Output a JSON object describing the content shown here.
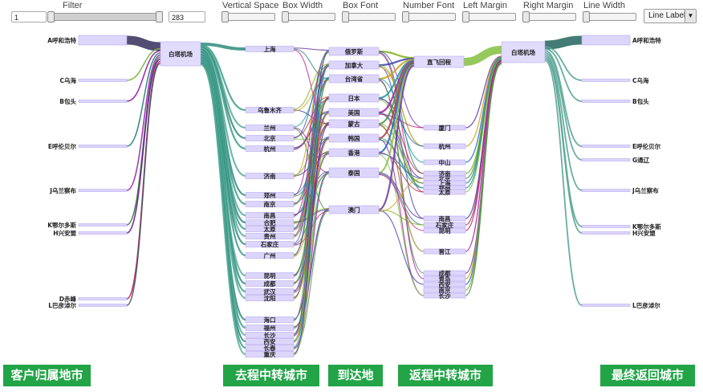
{
  "controls": {
    "filter": {
      "label": "Filter",
      "min_value": "1",
      "max_value": "283"
    },
    "sliders": [
      {
        "label": "Vertical Space"
      },
      {
        "label": "Box Width"
      },
      {
        "label": "Box Font"
      },
      {
        "label": "Number Font"
      },
      {
        "label": "Left Margin"
      },
      {
        "label": "Right Margin"
      },
      {
        "label": "Line Width"
      }
    ],
    "line_label_select": "Line Label"
  },
  "stages": [
    "客户归属地市",
    "去程中转城市",
    "到达地",
    "返程中转城市",
    "最终返回城市"
  ],
  "nodes": {
    "origin": [
      "A呼和浩特",
      "C乌海",
      "B包头",
      "E呼伦贝尔",
      "J乌兰察布",
      "K鄂尔多斯",
      "H兴安盟",
      "D赤峰",
      "L巴彦淖尔"
    ],
    "departure_hub": [
      "白塔机场"
    ],
    "outbound_transfer": [
      "上海",
      "乌鲁木齐",
      "兰州",
      "北京",
      "杭州",
      "济南",
      "郑州",
      "南京",
      "南昌",
      "合肥",
      "太原",
      "贵州",
      "石家庄",
      "广州",
      "昆明",
      "成都",
      "武汉",
      "沈阳",
      "海口",
      "福州",
      "长沙",
      "西安",
      "长春",
      "重庆"
    ],
    "destination": [
      "俄罗斯",
      "加拿大",
      "台湾省",
      "日本",
      "美国",
      "蒙古",
      "韩国",
      "香港",
      "泰国",
      "澳门"
    ],
    "direct": [
      "直飞回程"
    ],
    "return_transfer": [
      "厦门",
      "杭州",
      "中山",
      "济南",
      "北京",
      "上海",
      "郑州",
      "太原",
      "南昌",
      "石家庄",
      "昆明",
      "晋江",
      "成都",
      "青岛",
      "西安",
      "南京",
      "长沙"
    ],
    "return_hub": [
      "白塔机场"
    ],
    "final": [
      "A呼和浩特",
      "C乌海",
      "B包头",
      "E呼伦贝尔",
      "G通辽",
      "J乌兰察布",
      "K鄂尔多斯",
      "H兴安盟",
      "L巴彦淖尔"
    ]
  },
  "colors": {
    "stage_green": "#22a447",
    "node_fill": "#ddd6fb",
    "node_stroke": "#b7a9ef",
    "hub_fill": "#e2dcfc"
  }
}
